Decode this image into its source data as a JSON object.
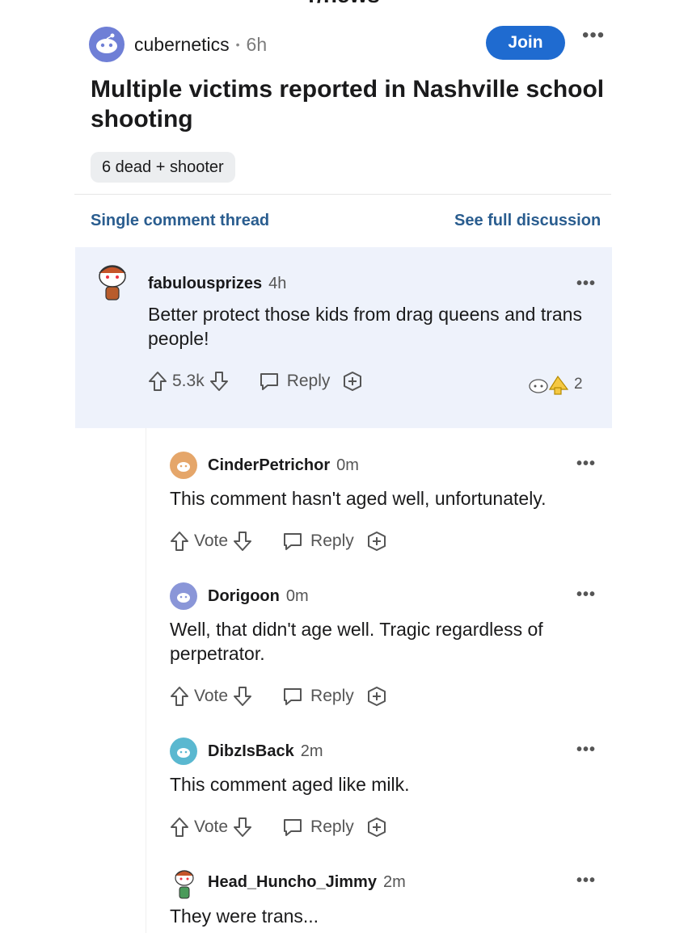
{
  "subreddit_header": "r/news",
  "post": {
    "subreddit": "cubernetics",
    "age": "6h",
    "join_label": "Join",
    "more_label": "•••",
    "title": "Multiple victims reported in Nashville school shooting",
    "flair": "6 dead + shooter"
  },
  "thread_nav": {
    "single_label": "Single comment thread",
    "full_label": "See full discussion"
  },
  "comments": [
    {
      "user": "fabulousprizes",
      "age": "4h",
      "body": "Better protect those kids from drag queens and trans people!",
      "votes": "5.3k",
      "reply_label": "Reply",
      "award_count": "2"
    },
    {
      "user": "CinderPetrichor",
      "age": "0m",
      "body": "This comment hasn't aged well, unfortunately.",
      "votes": "Vote",
      "reply_label": "Reply"
    },
    {
      "user": "Dorigoon",
      "age": "0m",
      "body": "Well, that didn't age well. Tragic regardless of perpetrator.",
      "votes": "Vote",
      "reply_label": "Reply"
    },
    {
      "user": "DibzIsBack",
      "age": "2m",
      "body": "This comment aged like milk.",
      "votes": "Vote",
      "reply_label": "Reply"
    },
    {
      "user": "Head_Huncho_Jimmy",
      "age": "2m",
      "body": "They were trans..."
    }
  ],
  "more_label": "•••",
  "colors": {
    "join": "#1f6bd0",
    "link": "#2a5d8f",
    "highlight_bg": "#eef2fb",
    "flair_bg": "#eceef0"
  }
}
